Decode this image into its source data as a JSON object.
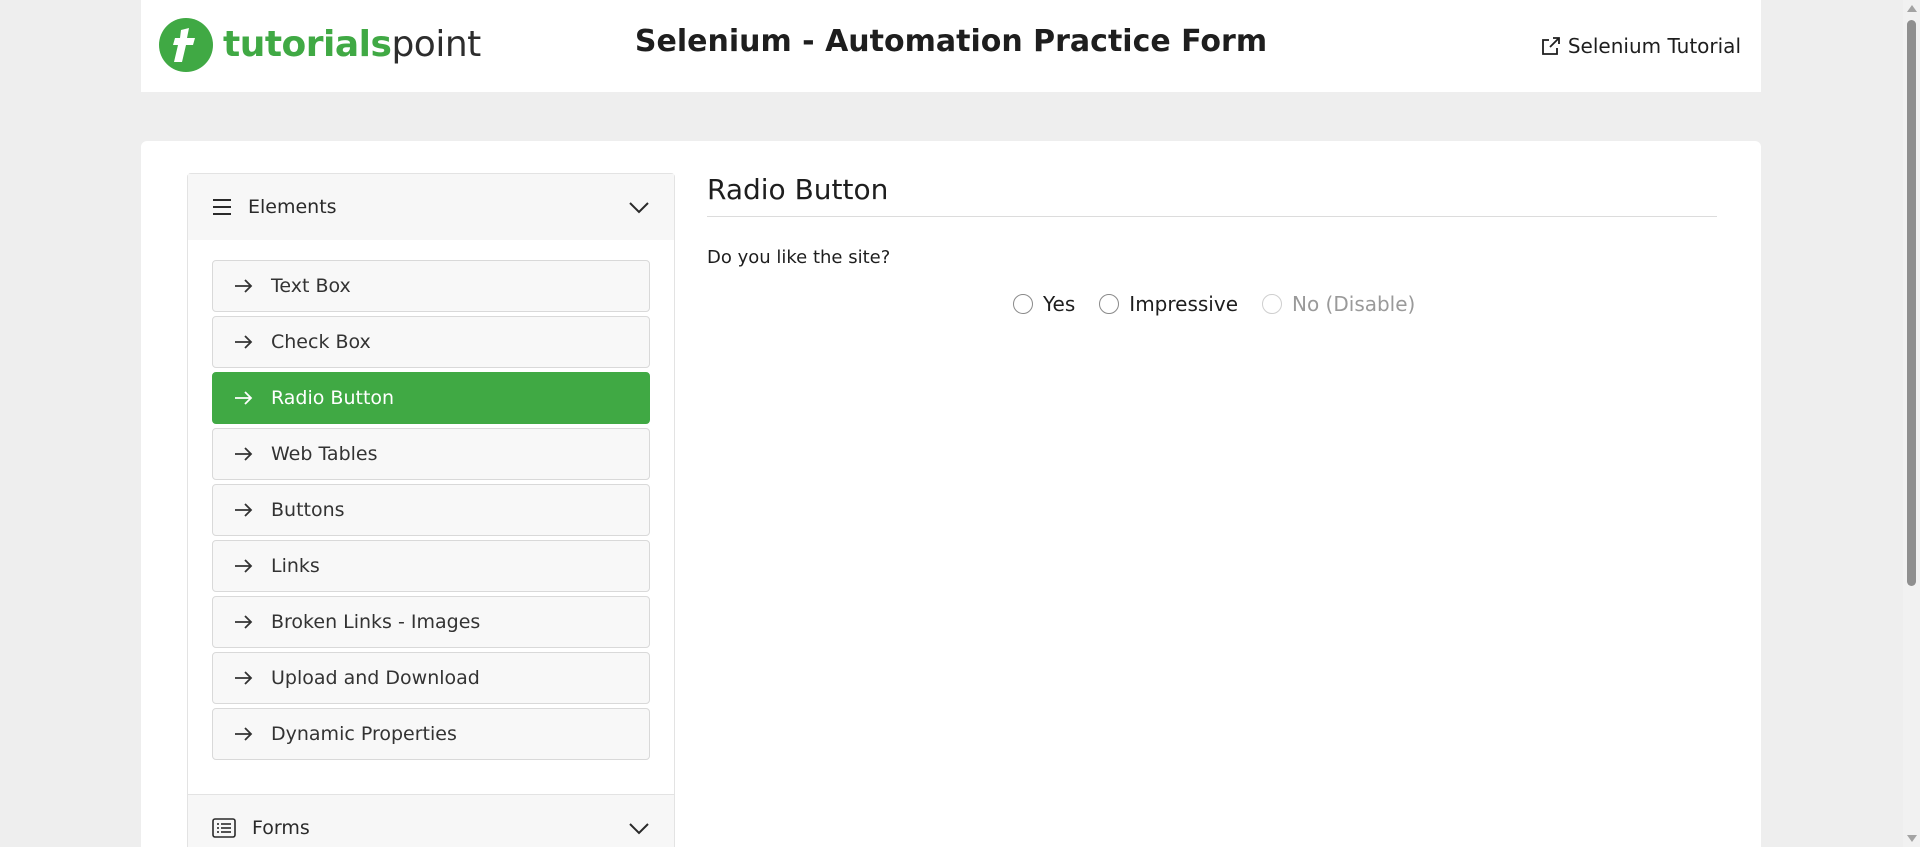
{
  "header": {
    "logo_text_1": "tutorials",
    "logo_text_2": "point",
    "title": "Selenium - Automation Practice Form",
    "tutorial_link": "Selenium Tutorial"
  },
  "sidebar": {
    "elements_label": "Elements",
    "items": [
      {
        "label": "Text Box"
      },
      {
        "label": "Check Box"
      },
      {
        "label": "Radio Button"
      },
      {
        "label": "Web Tables"
      },
      {
        "label": "Buttons"
      },
      {
        "label": "Links"
      },
      {
        "label": "Broken Links - Images"
      },
      {
        "label": "Upload and Download"
      },
      {
        "label": "Dynamic Properties"
      }
    ],
    "active_index": 2,
    "forms_label": "Forms"
  },
  "content": {
    "title": "Radio Button",
    "question": "Do you like the site?",
    "radios": [
      {
        "label": "Yes"
      },
      {
        "label": "Impressive"
      },
      {
        "label": "No (Disable)"
      }
    ]
  },
  "colors": {
    "accent": "#40a944",
    "page_bg": "#eeeeee"
  },
  "icons": {
    "logo": "tutorialspoint-logo-icon",
    "external_link": "external-link-icon",
    "menu": "hamburger-menu-icon",
    "chevron": "chevron-down-icon",
    "arrow": "arrow-right-icon",
    "forms": "list-icon"
  }
}
